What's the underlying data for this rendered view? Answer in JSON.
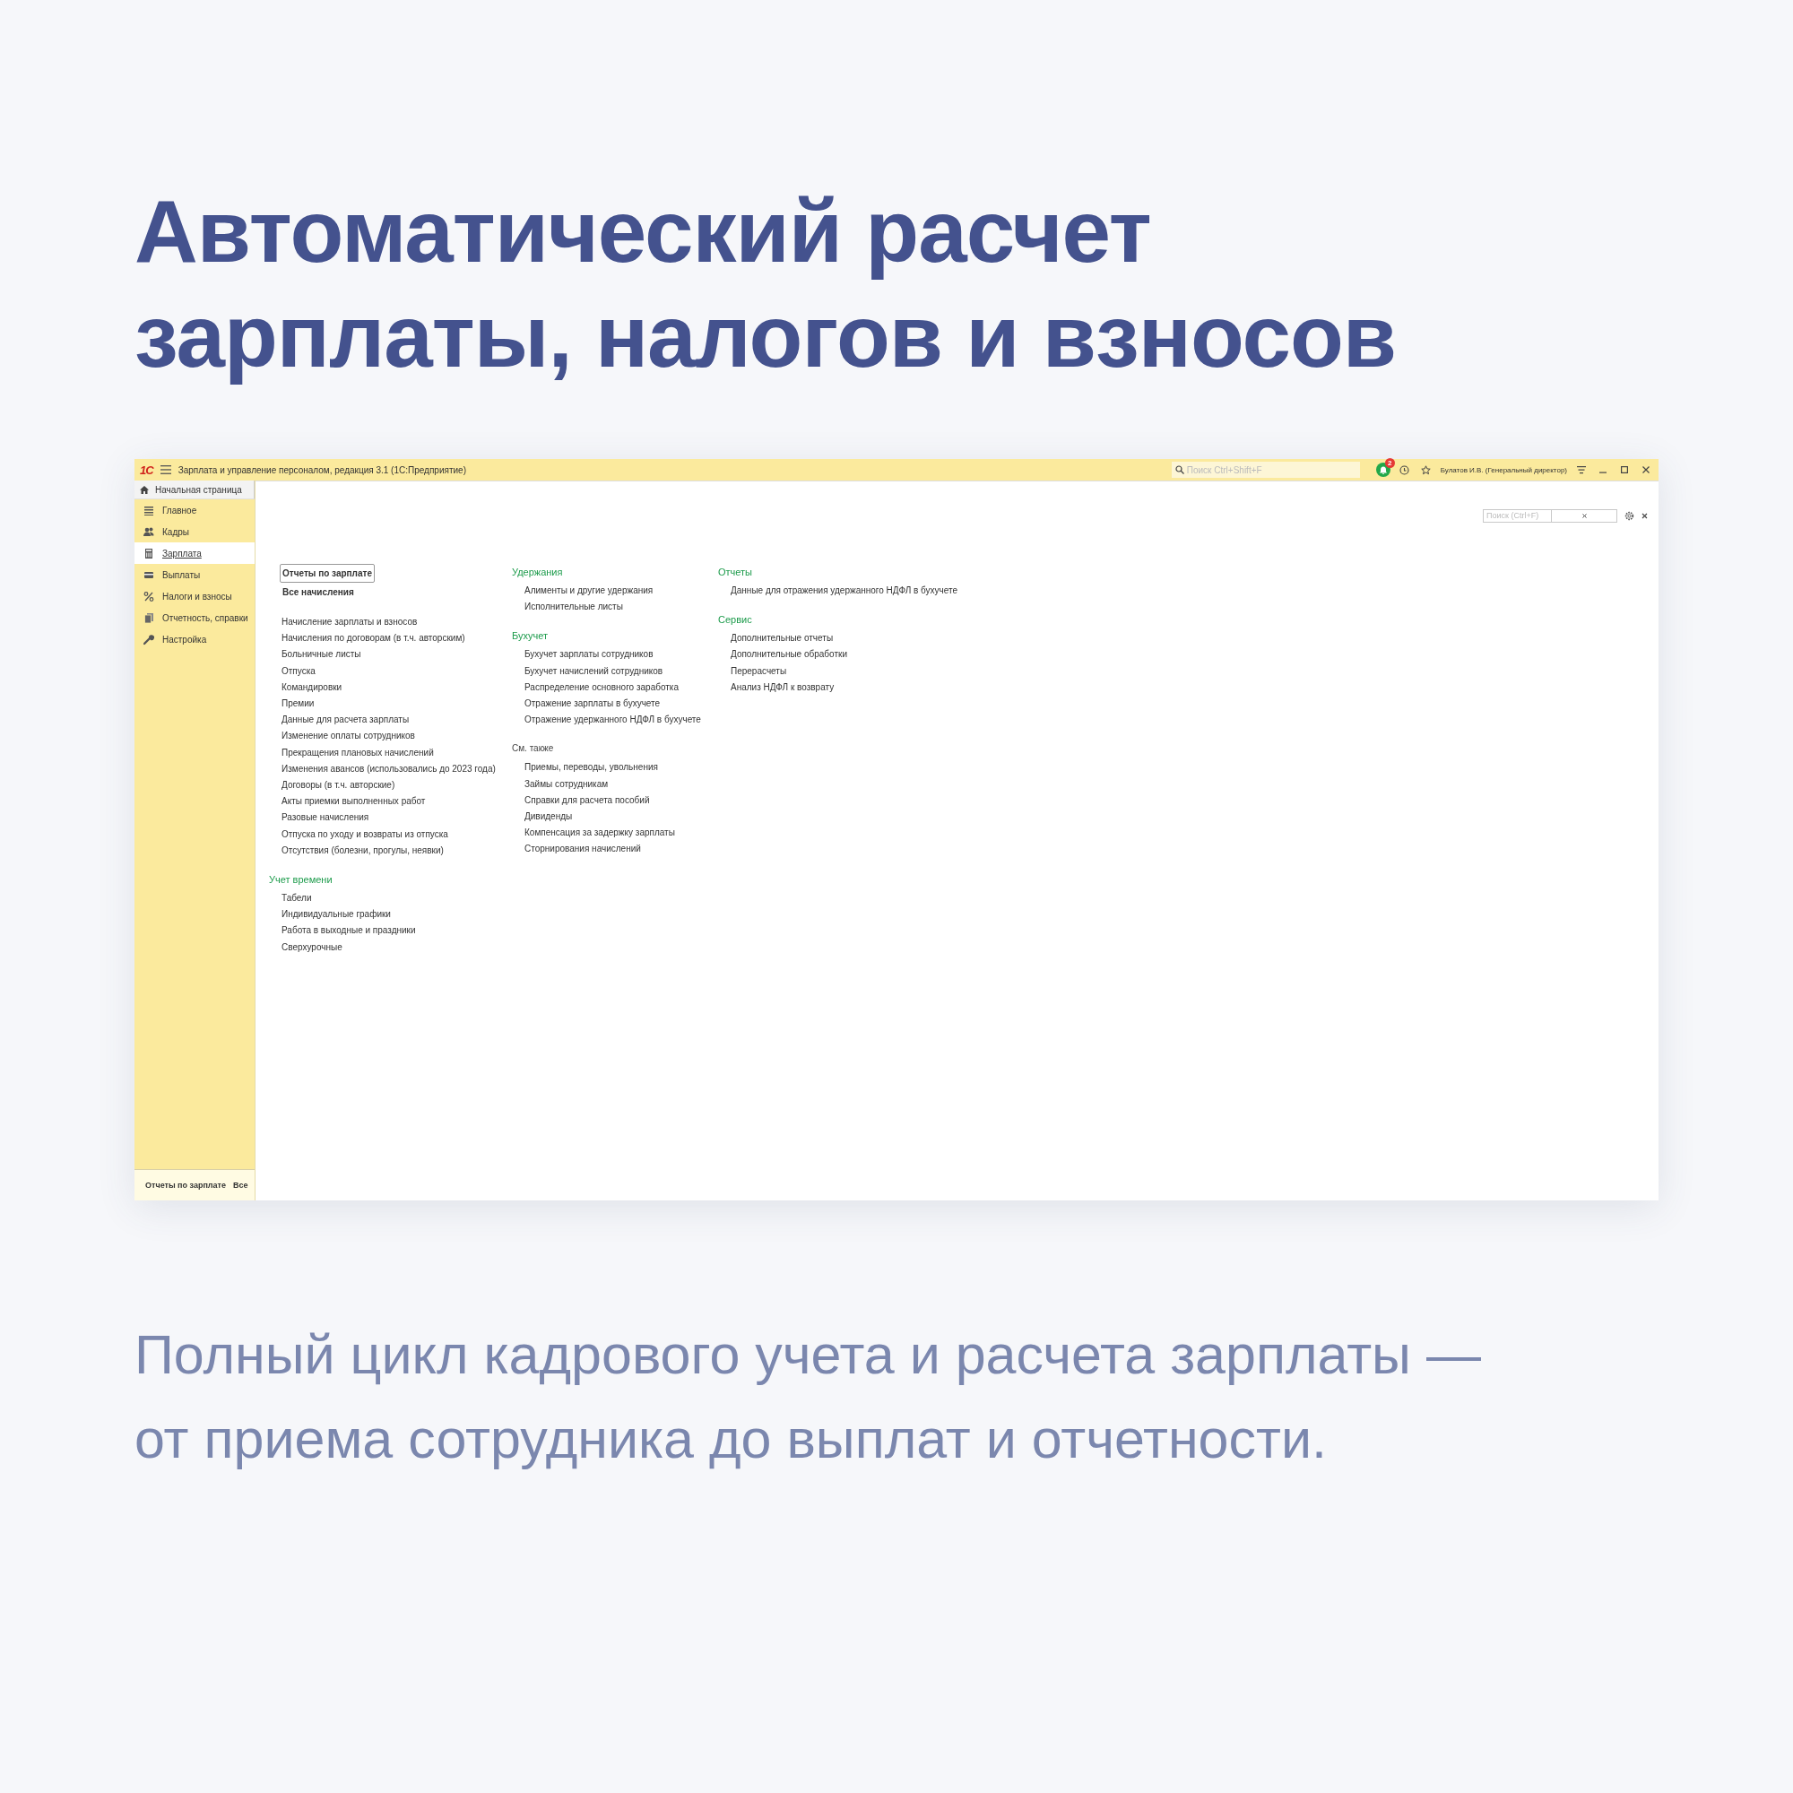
{
  "slide": {
    "title": "Автоматический расчет зарплаты, налогов и взносов",
    "subtitle": "Полный цикл кадрового учета и расчета зарплаты — от приема сотрудника до выплат и отчетности."
  },
  "window": {
    "logo": "1С",
    "title": "Зарплата и управление персоналом, редакция 3.1  (1С:Предприятие)",
    "search_placeholder": "Поиск Ctrl+Shift+F",
    "notifications": "2",
    "user": "Булатов И.В. (Генеральный директор)"
  },
  "home_tab": "Начальная страница",
  "sidebar": {
    "items": [
      {
        "label": "Главное",
        "selected": false
      },
      {
        "label": "Кадры",
        "selected": false
      },
      {
        "label": "Зарплата",
        "selected": true
      },
      {
        "label": "Выплаты",
        "selected": false
      },
      {
        "label": "Налоги и взносы",
        "selected": false
      },
      {
        "label": "Отчетность, справки",
        "selected": false
      },
      {
        "label": "Настройка",
        "selected": false
      }
    ],
    "footer": [
      "Отчеты по зарплате",
      "Все"
    ]
  },
  "panel": {
    "search_placeholder": "Поиск (Ctrl+F)",
    "columns": [
      [
        {
          "links": [
            {
              "text": "Отчеты по зарплате",
              "focused": true
            },
            {
              "text": "Все начисления",
              "focused": false
            }
          ]
        },
        {
          "items": [
            "Начисление зарплаты и взносов",
            "Начисления по договорам (в т.ч. авторским)",
            "Больничные листы",
            "Отпуска",
            "Командировки",
            "Премии",
            "Данные для расчета зарплаты",
            "Изменение оплаты сотрудников",
            "Прекращения плановых начислений",
            "Изменения авансов (использовались до 2023 года)",
            "Договоры (в т.ч. авторские)",
            "Акты приемки выполненных работ",
            "Разовые начисления",
            "Отпуска по уходу и возвраты из отпуска",
            "Отсутствия (болезни, прогулы, неявки)"
          ]
        },
        {
          "heading": "Учет времени",
          "highlighted": true,
          "items": [
            "Табели",
            "Индивидуальные графики",
            "Работа в выходные и праздники",
            "Сверхурочные"
          ]
        }
      ],
      [
        {
          "heading": "Удержания",
          "highlighted": true,
          "items": [
            "Алименты и другие удержания",
            "Исполнительные листы"
          ]
        },
        {
          "heading": "Бухучет",
          "highlighted": true,
          "items": [
            "Бухучет зарплаты сотрудников",
            "Бухучет начислений сотрудников",
            "Распределение основного заработка",
            "Отражение зарплаты в бухучете",
            "Отражение удержанного НДФЛ в бухучете"
          ]
        },
        {
          "heading": "См. также",
          "highlighted": false,
          "items": [
            "Приемы, переводы, увольнения",
            "Займы сотрудникам",
            "Справки для расчета пособий",
            "Дивиденды",
            "Компенсация за задержку зарплаты",
            "Сторнирования начислений"
          ]
        }
      ],
      [
        {
          "heading": "Отчеты",
          "highlighted": true,
          "items": [
            "Данные для отражения удержанного НДФЛ в бухучете"
          ]
        },
        {
          "heading": "Сервис",
          "highlighted": true,
          "items": [
            "Дополнительные отчеты",
            "Дополнительные обработки",
            "Перерасчеты",
            "Анализ НДФЛ к возврату"
          ]
        }
      ]
    ]
  }
}
